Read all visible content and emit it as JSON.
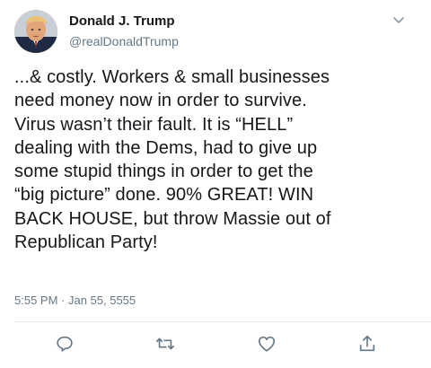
{
  "tweet": {
    "author": {
      "display_name": "Donald J. Trump",
      "handle": "@realDonaldTrump"
    },
    "text_lines": [
      "...& costly. Workers & small businesses",
      "need money now in order to survive.",
      "Virus wasn’t their fault. It is “HELL”",
      "dealing with the Dems, had to give up",
      "some stupid things in order to get the",
      "“big picture” done. 90% GREAT! WIN",
      "BACK HOUSE, but throw Massie out of",
      "Republican Party!"
    ],
    "timestamp": "5:55 PM · Jan 55, 5555"
  },
  "icons": {
    "menu": "chevron-down-icon",
    "reply": "reply-icon",
    "retweet": "retweet-icon",
    "like": "heart-icon",
    "share": "share-icon"
  },
  "colors": {
    "text_primary": "#14171a",
    "text_secondary": "#657786",
    "icon": "#657786",
    "divider": "#e6ecf0"
  }
}
